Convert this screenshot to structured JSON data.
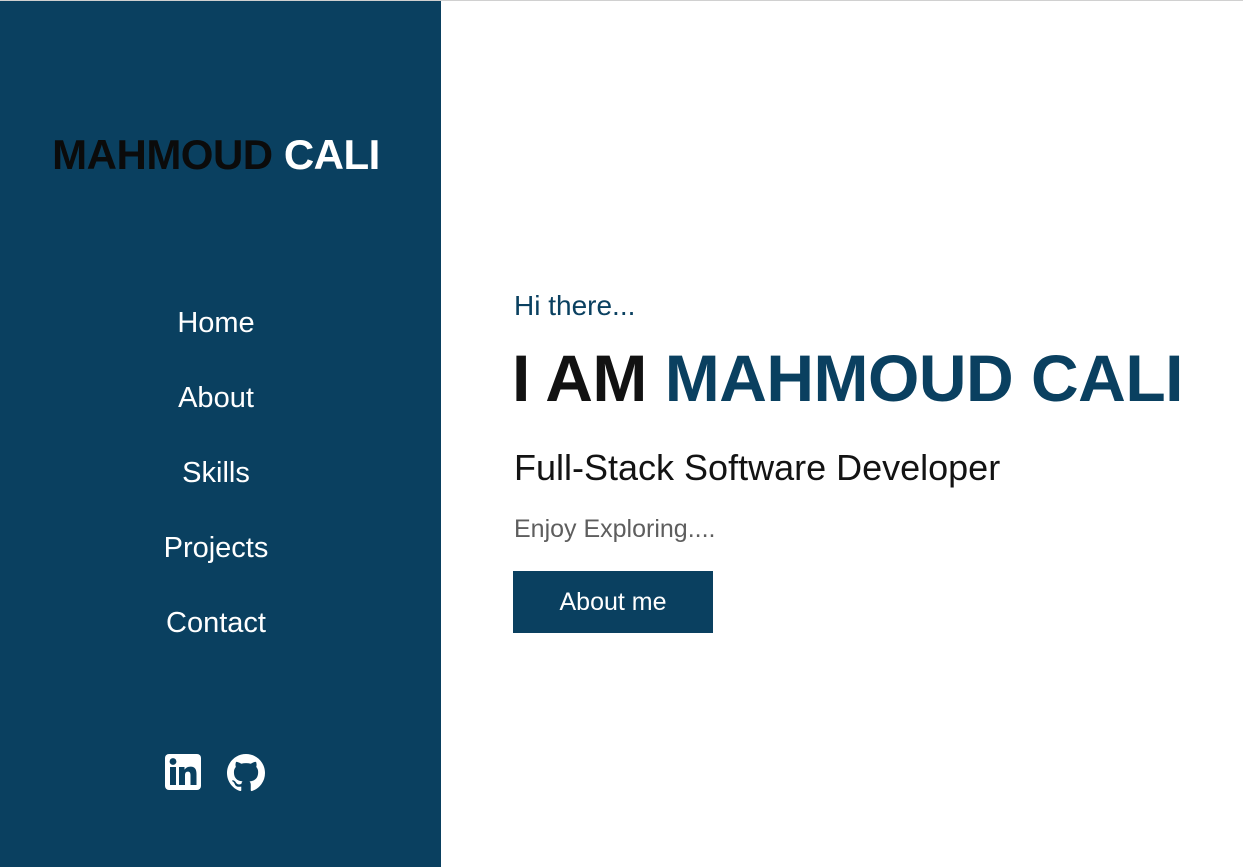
{
  "sidebar": {
    "logo": {
      "first": "MAHMOUD",
      "last": "CALI"
    },
    "nav": [
      {
        "label": "Home"
      },
      {
        "label": "About"
      },
      {
        "label": "Skills"
      },
      {
        "label": "Projects"
      },
      {
        "label": "Contact"
      }
    ],
    "socials": [
      {
        "icon": "linkedin-icon"
      },
      {
        "icon": "github-icon"
      }
    ]
  },
  "hero": {
    "greeting": "Hi there...",
    "headline_prefix": "I AM",
    "headline_name": "MAHMOUD CALI",
    "role": "Full-Stack Software Developer",
    "tagline": "Enjoy Exploring....",
    "button_label": "About me"
  },
  "colors": {
    "primary": "#0a4060",
    "background": "#ffffff",
    "text_dark": "#121212",
    "text_muted": "#5e5e5e"
  }
}
